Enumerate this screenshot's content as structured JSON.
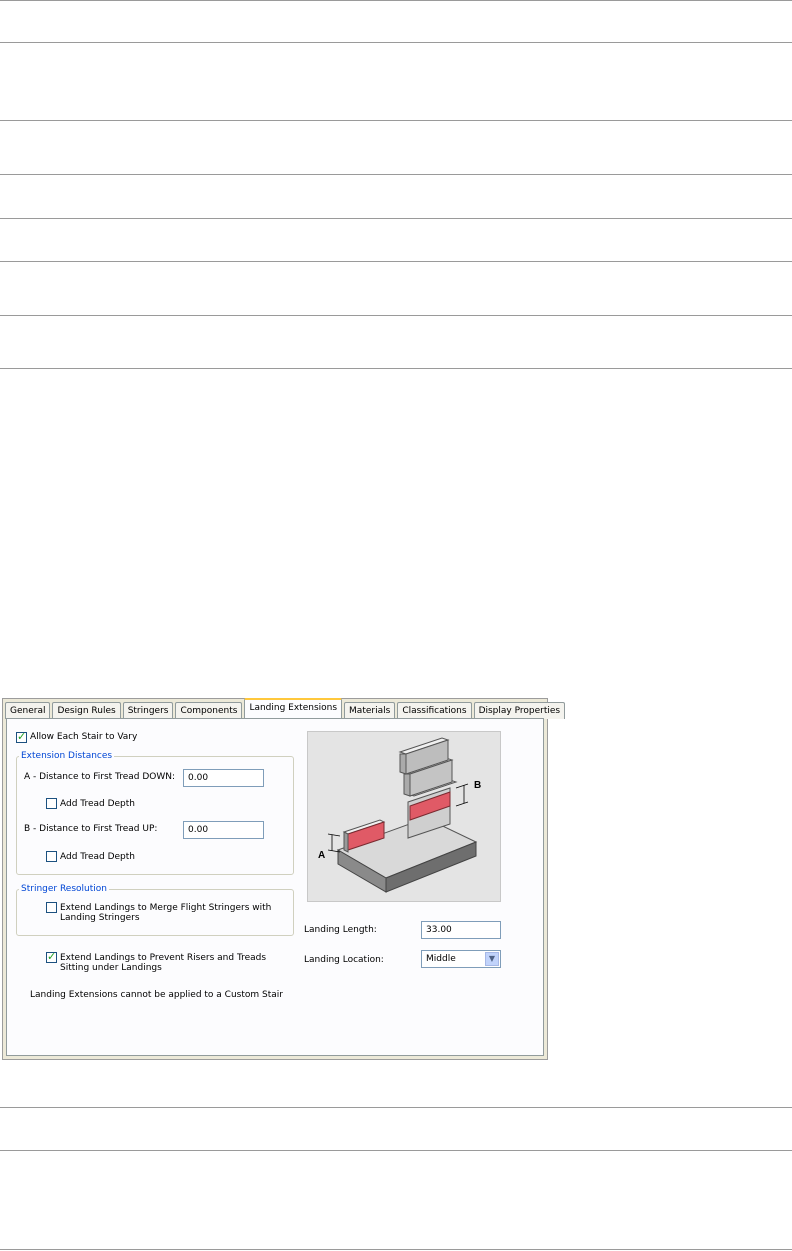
{
  "tabs": [
    {
      "label": "General",
      "active": false
    },
    {
      "label": "Design Rules",
      "active": false
    },
    {
      "label": "Stringers",
      "active": false
    },
    {
      "label": "Components",
      "active": false
    },
    {
      "label": "Landing Extensions",
      "active": true
    },
    {
      "label": "Materials",
      "active": false
    },
    {
      "label": "Classifications",
      "active": false
    },
    {
      "label": "Display Properties",
      "active": false
    }
  ],
  "allow_vary": {
    "label": "Allow Each Stair to Vary",
    "checked": true
  },
  "extension_distances": {
    "legend": "Extension Distances",
    "a_label": "A - Distance to First Tread DOWN:",
    "a_value": "0.00",
    "a_add_tread": {
      "label": "Add Tread Depth",
      "checked": false
    },
    "b_label": "B - Distance to First Tread UP:",
    "b_value": "0.00",
    "b_add_tread": {
      "label": "Add Tread Depth",
      "checked": false
    }
  },
  "stringer_resolution": {
    "legend": "Stringer Resolution",
    "merge": {
      "label_line1": "Extend Landings to Merge Flight Stringers with",
      "label_line2": "Landing Stringers",
      "checked": false
    }
  },
  "prevent": {
    "label_line1": "Extend Landings to Prevent Risers and Treads",
    "label_line2": "Sitting under Landings",
    "checked": true
  },
  "note": "Landing Extensions cannot be applied to a Custom Stair",
  "landing_length": {
    "label": "Landing Length:",
    "value": "33.00"
  },
  "landing_location": {
    "label": "Landing Location:",
    "value": "Middle"
  },
  "diagram": {
    "label_a": "A",
    "label_b": "B"
  },
  "colors": {
    "accent": "#ffc83c",
    "legend_blue": "#0046d5",
    "highlight_red": "#e05a66"
  }
}
